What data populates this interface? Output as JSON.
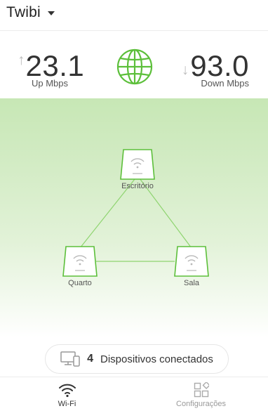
{
  "header": {
    "network_name": "Twibi",
    "dropdown_icon": "caret-down-icon"
  },
  "speed": {
    "upload": {
      "value": "23.1",
      "unit": "Up Mbps",
      "arrow": "↑"
    },
    "download": {
      "value": "93.0",
      "unit": "Down Mbps",
      "arrow": "↓"
    },
    "status_icon": "globe-icon"
  },
  "mesh": {
    "nodes": [
      {
        "label": "Escritório"
      },
      {
        "label": "Quarto"
      },
      {
        "label": "Sala"
      }
    ],
    "accent_color": "#5cbf3a"
  },
  "devices": {
    "count": "4",
    "label": "Dispositivos conectados",
    "icon": "devices-icon"
  },
  "tabbar": {
    "tabs": [
      {
        "label": "Wi-Fi",
        "icon": "wifi-icon",
        "active": true
      },
      {
        "label": "Configurações",
        "icon": "settings-grid-icon",
        "active": false
      }
    ]
  }
}
